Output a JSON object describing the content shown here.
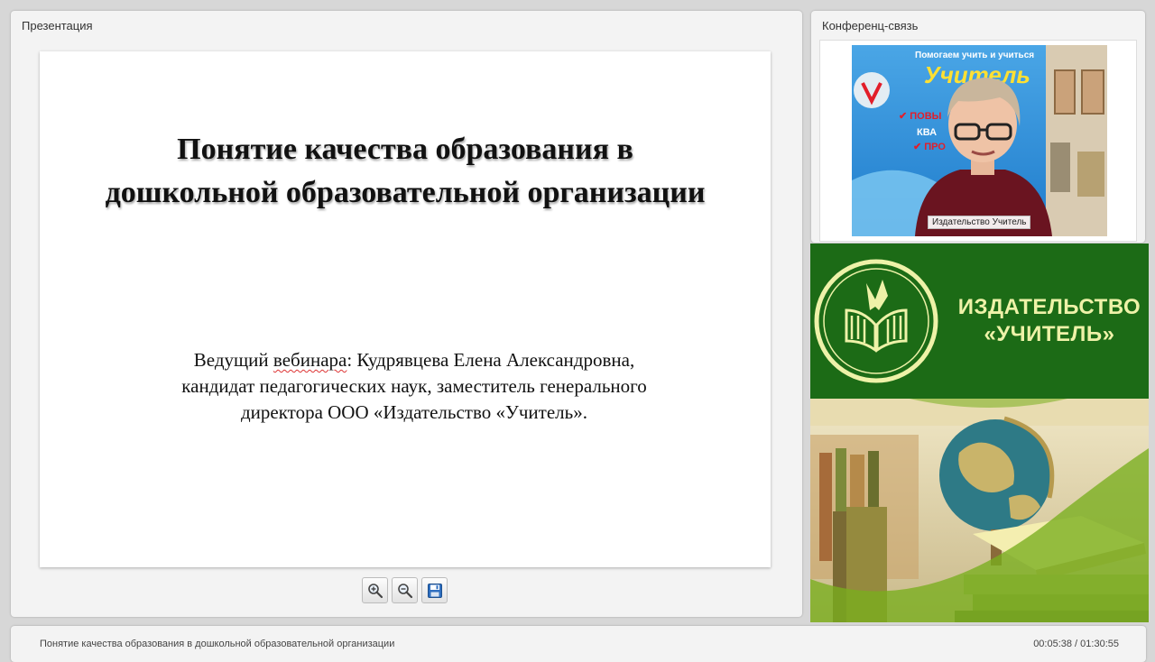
{
  "presentation": {
    "panel_title": "Презентация",
    "slide": {
      "title": "Понятие качества образования в дошкольной образовательной организации",
      "presenter_label": "Ведущий",
      "presenter_label_underlined": "вебинара",
      "presenter_line1_rest": ": Кудрявцева Елена Александровна,",
      "presenter_line2": "кандидат педагогических наук, заместитель генерального",
      "presenter_line3": "директора ООО «Издательство «Учитель»."
    },
    "toolbar": {
      "zoom_in_icon": "zoom-in-icon",
      "zoom_out_icon": "zoom-out-icon",
      "save_icon": "save-icon"
    }
  },
  "conference": {
    "panel_title": "Конференц-связь",
    "video_label": "Издательство Учитель",
    "backdrop_text_1": "Помогаем учить и учиться",
    "backdrop_text_2": "Учитель",
    "backdrop_text_3": "✔ ПОВЫ",
    "backdrop_text_4": "КВА",
    "backdrop_text_5": "✔ ПРО"
  },
  "banner": {
    "line1": "ИЗДАТЕЛЬСТВО",
    "line2": "«УЧИТЕЛЬ»",
    "bg_color": "#1c6b16",
    "text_color": "#eef2a8"
  },
  "footer": {
    "title": "Понятие качества образования в дошкольной образовательной организации",
    "time": "00:05:38 / 01:30:55"
  }
}
